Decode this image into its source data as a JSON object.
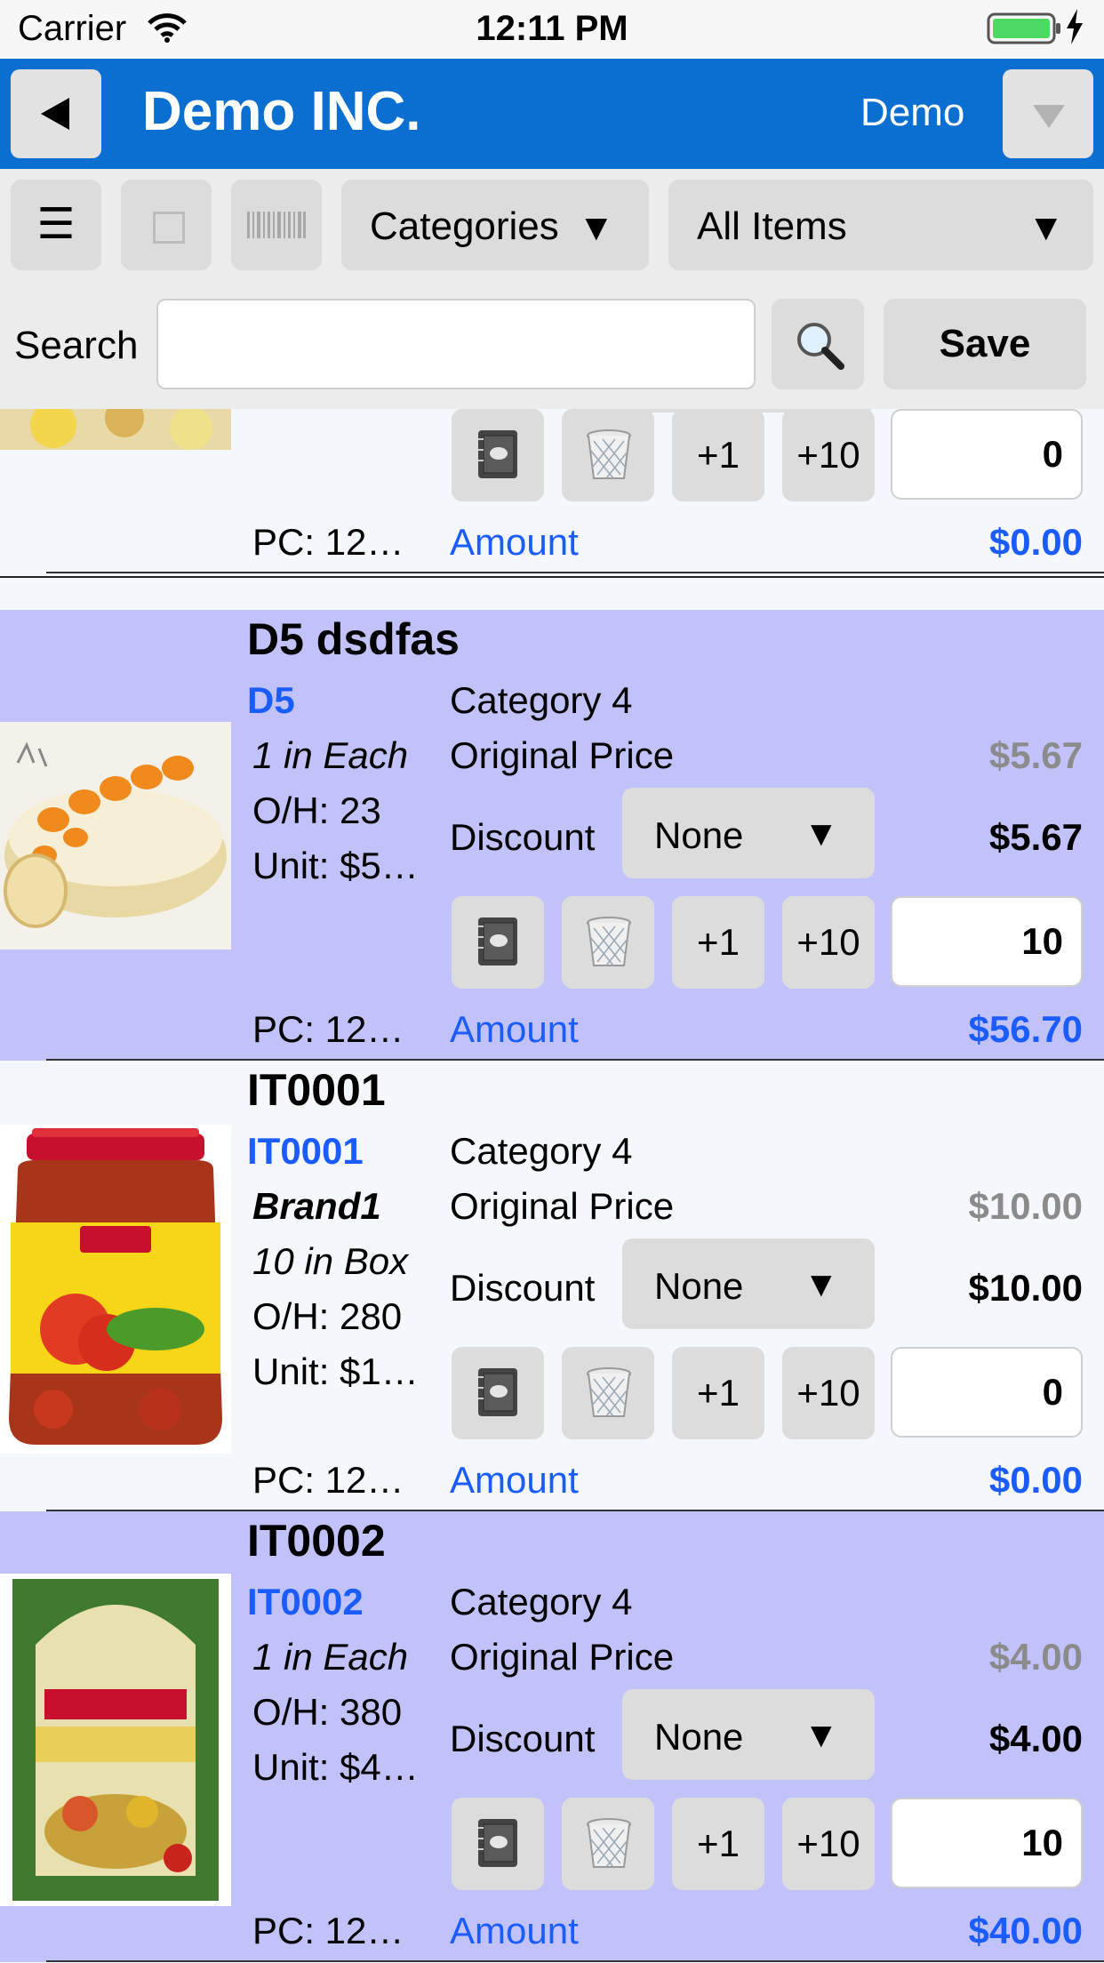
{
  "status_bar": {
    "carrier": "Carrier",
    "time": "12:11 PM"
  },
  "nav": {
    "title": "Demo INC.",
    "user": "Demo"
  },
  "toolbar": {
    "list_icon": "☰",
    "categories_label": "Categories",
    "items_label": "All Items",
    "dropdown_arrow": "▼",
    "search_label": "Search",
    "search_value": "",
    "save_label": "Save"
  },
  "partial_row": {
    "quantity": "0",
    "pc": "PC: 12…",
    "amount_label": "Amount",
    "amount": "$0.00",
    "plus1": "+1",
    "plus10": "+10"
  },
  "items": [
    {
      "name": "D5 dsdfas",
      "code": "D5",
      "pack": "1 in Each",
      "on_hand": "O/H: 23",
      "unit": "Unit: $5…",
      "category": "Category 4",
      "original_price_label": "Original Price",
      "original_price": "$5.67",
      "discount_label": "Discount",
      "discount": "None",
      "price": "$5.67",
      "quantity": "10",
      "pc": "PC: 12…",
      "amount_label": "Amount",
      "amount": "$56.70",
      "plus1": "+1",
      "plus10": "+10"
    },
    {
      "name": "IT0001",
      "code": "IT0001",
      "brand": "Brand1",
      "pack": "10 in Box",
      "on_hand": "O/H: 280",
      "unit": "Unit: $1…",
      "category": "Category 4",
      "original_price_label": "Original Price",
      "original_price": "$10.00",
      "discount_label": "Discount",
      "discount": "None",
      "price": "$10.00",
      "quantity": "0",
      "pc": "PC: 12…",
      "amount_label": "Amount",
      "amount": "$0.00",
      "plus1": "+1",
      "plus10": "+10"
    },
    {
      "name": "IT0002",
      "code": "IT0002",
      "pack": "1 in Each",
      "on_hand": "O/H: 380",
      "unit": "Unit: $4…",
      "category": "Category 4",
      "original_price_label": "Original Price",
      "original_price": "$4.00",
      "discount_label": "Discount",
      "discount": "None",
      "price": "$4.00",
      "quantity": "10",
      "pc": "PC: 12…",
      "amount_label": "Amount",
      "amount": "$40.00",
      "plus1": "+1",
      "plus10": "+10"
    }
  ],
  "colors": {
    "nav_blue": "#0a6fd0",
    "row_highlight": "#c2c2fb",
    "link_blue": "#1a5cff",
    "muted_price": "#8b8b8b"
  },
  "icons": [
    "wifi-icon",
    "battery-icon",
    "back-arrow-icon",
    "dropdown-icon",
    "list-icon",
    "square-icon",
    "barcode-icon",
    "search-icon",
    "notebook-icon",
    "trash-icon"
  ]
}
